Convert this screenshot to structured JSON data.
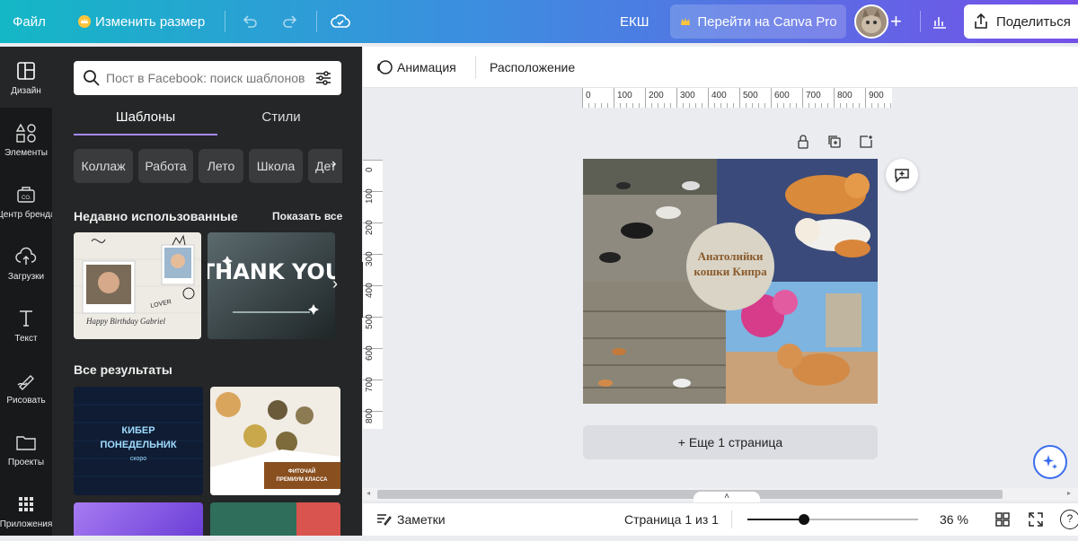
{
  "topbar": {
    "file": "Файл",
    "resize": "Изменить размер",
    "doc_title": "ЕКШ",
    "pro": "Перейти на Canva Pro",
    "share": "Поделиться"
  },
  "rail": [
    {
      "label": "Дизайн",
      "icon": "layout-icon"
    },
    {
      "label": "Элементы",
      "icon": "shapes-icon"
    },
    {
      "label": "Центр бренда",
      "icon": "brand-icon"
    },
    {
      "label": "Загрузки",
      "icon": "cloud-upload-icon"
    },
    {
      "label": "Текст",
      "icon": "text-icon"
    },
    {
      "label": "Рисовать",
      "icon": "draw-icon"
    },
    {
      "label": "Проекты",
      "icon": "folder-icon"
    },
    {
      "label": "Приложения",
      "icon": "apps-icon"
    }
  ],
  "panel": {
    "search_placeholder": "Пост в Facebook: поиск шаблонов",
    "tabs": [
      "Шаблоны",
      "Стили"
    ],
    "chips": [
      "Коллаж",
      "Работа",
      "Лето",
      "Школа",
      "Дет"
    ],
    "recent_title": "Недавно использованные",
    "show_all": "Показать все",
    "all_results": "Все результаты",
    "thumb1_text": "Happy Birthday Gabriel",
    "thumb1_lover": "LOVER",
    "thumb2_text": "THANK YOU",
    "thumb3_text": "КИБЕР ПОНЕДЕЛЬНИК",
    "thumb3_sub": "скоро",
    "thumb4_text": "ФИТОЧАЙ ПРЕМИУМ КЛАССА"
  },
  "toolbar": {
    "animation": "Анимация",
    "position": "Расположение"
  },
  "ruler_h": [
    "0",
    "100",
    "200",
    "300",
    "400",
    "500",
    "600",
    "700",
    "800",
    "900"
  ],
  "ruler_v": [
    "0",
    "100",
    "200",
    "300",
    "400",
    "500",
    "600",
    "700",
    "800"
  ],
  "design": {
    "circle_text": "Анатолийки кошки Кипра"
  },
  "add_page": "+ Еще 1 страница",
  "bottom": {
    "notes": "Заметки",
    "page": "Страница 1 из 1",
    "zoom": "36 %",
    "zoom_fraction": 0.33
  },
  "colors": {
    "accent": "#8b3dff",
    "panel_bg": "#252627",
    "rail_bg": "#18191b",
    "circle": "#d9d4c6",
    "circle_text": "#8a5a2b"
  }
}
